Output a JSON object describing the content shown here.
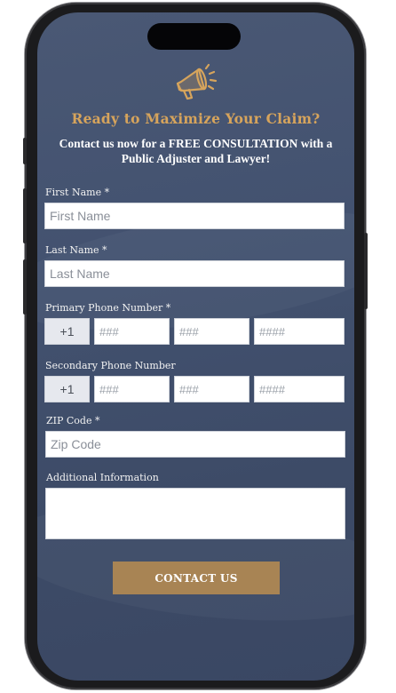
{
  "header": {
    "title": "Ready to Maximize Your Claim?",
    "subtitle": "Contact us now for a FREE CONSULTATION with a Public Adjuster and Lawyer!",
    "icon": "megaphone-icon",
    "accent_color": "#d6a45c"
  },
  "form": {
    "first_name": {
      "label": "First Name *",
      "placeholder": "First Name"
    },
    "last_name": {
      "label": "Last Name *",
      "placeholder": "Last Name"
    },
    "primary_phone": {
      "label": "Primary Phone Number *",
      "prefix": "+1",
      "area_placeholder": "###",
      "exchange_placeholder": "###",
      "line_placeholder": "####"
    },
    "secondary_phone": {
      "label": "Secondary Phone Number",
      "prefix": "+1",
      "area_placeholder": "###",
      "exchange_placeholder": "###",
      "line_placeholder": "####"
    },
    "zip": {
      "label": "ZIP Code *",
      "placeholder": "Zip Code"
    },
    "additional": {
      "label": "Additional Information",
      "value": ""
    },
    "submit_label": "CONTACT US",
    "submit_color": "#a88454"
  },
  "theme": {
    "background": "#435270",
    "phone_frame": "#1b1b1d"
  }
}
